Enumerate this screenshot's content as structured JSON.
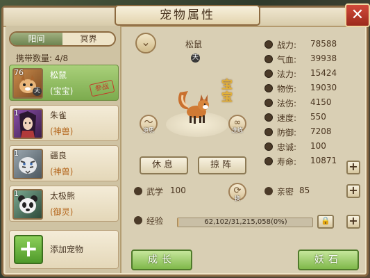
{
  "window": {
    "title": "宠物属性",
    "close_label": "✕"
  },
  "tabs": [
    {
      "label": "阳间",
      "active": true
    },
    {
      "label": "冥界",
      "active": false
    }
  ],
  "carry_count": {
    "label": "携带数量:",
    "value": "4/8"
  },
  "pets": [
    {
      "level": "76",
      "badge": "天",
      "name": "松鼠",
      "type": "(宝宝)",
      "stamp": "参战",
      "selected": true
    },
    {
      "level": "1",
      "badge": "",
      "name": "朱雀",
      "type": "(神兽)",
      "stamp": "",
      "selected": false
    },
    {
      "level": "1",
      "badge": "",
      "name": "疆良",
      "type": "(神兽)",
      "stamp": "",
      "selected": false
    },
    {
      "level": "1",
      "badge": "",
      "name": "太极熊",
      "type": "(御灵)",
      "stamp": "",
      "selected": false
    }
  ],
  "add_pet_label": "添加宠物",
  "selected_pet": {
    "name": "松鼠",
    "badge": "天",
    "tag": "宝宝"
  },
  "side_buttons": {
    "left_caption": "资质",
    "right_caption": "洗练"
  },
  "actions": {
    "rest": "休息",
    "formation": "掠阵"
  },
  "stats": [
    {
      "label": "战力:",
      "value": "78588"
    },
    {
      "label": "气血:",
      "value": "39938"
    },
    {
      "label": "法力:",
      "value": "15424"
    },
    {
      "label": "物伤:",
      "value": "19030"
    },
    {
      "label": "法伤:",
      "value": "4150"
    },
    {
      "label": "速度:",
      "value": "550"
    },
    {
      "label": "防御:",
      "value": "7208"
    },
    {
      "label": "忠诚:",
      "value": "100"
    },
    {
      "label": "寿命:",
      "value": "10871"
    }
  ],
  "wuxue": {
    "label": "武学",
    "value": "100",
    "swap_caption": "换"
  },
  "intimacy": {
    "label": "亲密",
    "value": "85"
  },
  "exp": {
    "label": "经验",
    "text": "62,102/31,215,058(0%)",
    "fraction": 0.002
  },
  "bottom": {
    "grow": "成长",
    "demon_stone": "妖石"
  }
}
